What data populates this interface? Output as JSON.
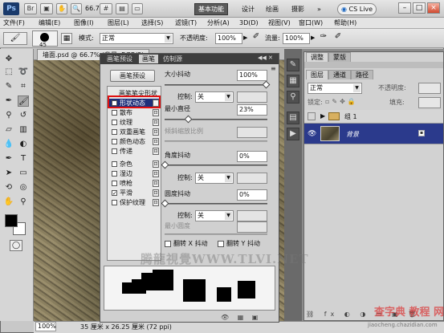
{
  "titlebar": {
    "logo": "Ps",
    "zoom": "66.7",
    "workspaces": [
      "基本功能",
      "设计",
      "绘画",
      "摄影"
    ],
    "more": "»",
    "cslive": "CS Live"
  },
  "menu": [
    "文件(F)",
    "编辑(E)",
    "图像(I)",
    "图层(L)",
    "选择(S)",
    "滤镜(T)",
    "分析(A)",
    "3D(D)",
    "视图(V)",
    "窗口(W)",
    "帮助(H)"
  ],
  "options": {
    "brush_size": "45",
    "mode_label": "模式:",
    "mode_value": "正常",
    "opacity_label": "不透明度:",
    "opacity_value": "100%",
    "flow_label": "流量:",
    "flow_value": "100%"
  },
  "document": {
    "tab": "墙面.psd @ 66.7% (背景, RGB/8)",
    "zoom": "100%",
    "status": "35 厘米 x 26.25 厘米 (72 ppi)"
  },
  "brush_panel": {
    "tabs": [
      "画笔预设",
      "画笔",
      "仿制源"
    ],
    "preset_button": "画笔预设",
    "tip_shape": "画笔笔尖形状",
    "items": [
      {
        "label": "形状动态",
        "checked": true,
        "selected": true
      },
      {
        "label": "散布",
        "checked": false
      },
      {
        "label": "纹理",
        "checked": false
      },
      {
        "label": "双重画笔",
        "checked": false
      },
      {
        "label": "颜色动态",
        "checked": false
      },
      {
        "label": "传递",
        "checked": false
      },
      {
        "label": "杂色",
        "checked": false
      },
      {
        "label": "湿边",
        "checked": false
      },
      {
        "label": "喷枪",
        "checked": false
      },
      {
        "label": "平滑",
        "checked": true
      },
      {
        "label": "保护纹理",
        "checked": false
      }
    ],
    "size_jitter_label": "大小抖动",
    "size_jitter_value": "100%",
    "control_label": "控制:",
    "control_value": "关",
    "min_diameter_label": "最小直径",
    "min_diameter_value": "23%",
    "tilt_scale_label": "倾斜缩放比例",
    "angle_jitter_label": "角度抖动",
    "angle_jitter_value": "0%",
    "roundness_jitter_label": "圆度抖动",
    "roundness_jitter_value": "0%",
    "min_roundness_label": "最小圆度",
    "flip_x": "翻转 X 抖动",
    "flip_y": "翻转 Y 抖动"
  },
  "layers_panel": {
    "top_tabs": [
      "调整",
      "蒙版"
    ],
    "tabs": [
      "图层",
      "通道",
      "路径"
    ],
    "blend_mode": "正常",
    "opacity_label": "不透明度:",
    "lock_label": "锁定:",
    "fill_label": "填充:",
    "group_name": "组 1",
    "layer_name": "背景"
  },
  "watermarks": {
    "main": "腾龍視覺WWW.TLVI.NET",
    "corner": "查字典 教程 网",
    "corner_url": "jiaocheng.chazidian.com"
  }
}
